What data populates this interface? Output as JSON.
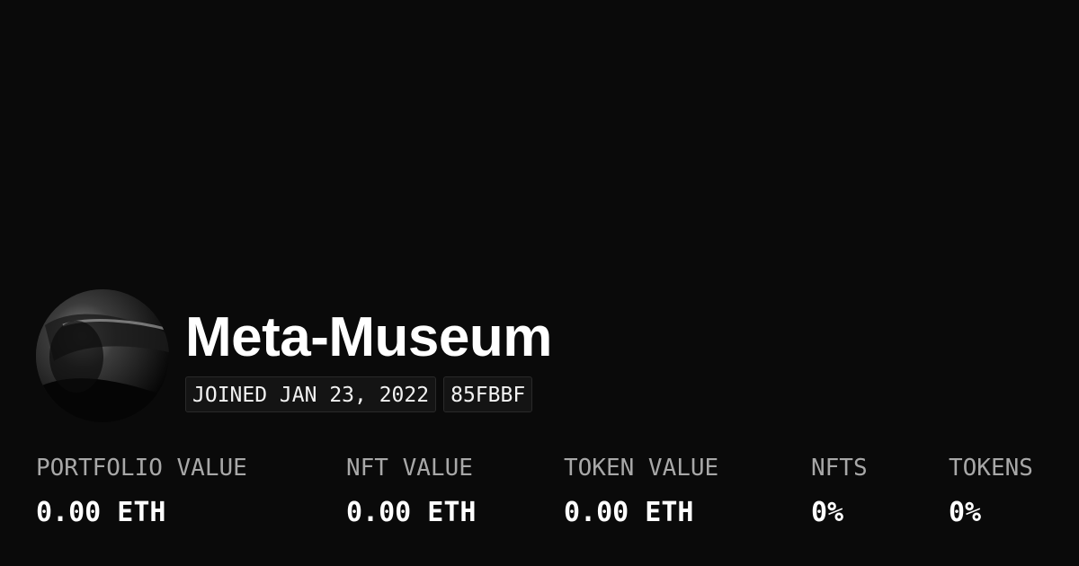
{
  "profile": {
    "name": "Meta-Museum",
    "joined": "JOINED JAN 23, 2022",
    "id_tag": "85FBBF"
  },
  "stats": [
    {
      "label": "PORTFOLIO VALUE",
      "value": "0.00 ETH"
    },
    {
      "label": "NFT VALUE",
      "value": "0.00 ETH"
    },
    {
      "label": "TOKEN VALUE",
      "value": "0.00 ETH"
    },
    {
      "label": "NFTS",
      "value": "0%"
    },
    {
      "label": "TOKENS",
      "value": "0%"
    }
  ],
  "colors": {
    "background": "#0a0a0a",
    "text": "#ffffff",
    "muted": "#a8a8a8",
    "badge_bg": "#141414"
  }
}
